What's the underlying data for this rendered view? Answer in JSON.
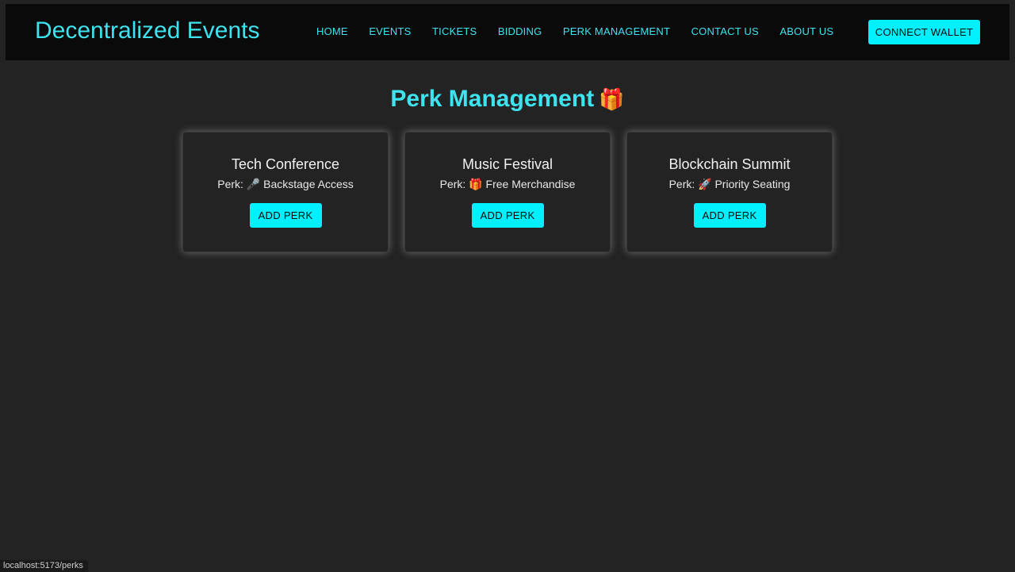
{
  "header": {
    "brand": "Decentralized Events",
    "nav": [
      {
        "label": "HOME"
      },
      {
        "label": "EVENTS"
      },
      {
        "label": "TICKETS"
      },
      {
        "label": "BIDDING"
      },
      {
        "label": "PERK MANAGEMENT"
      },
      {
        "label": "CONTACT US"
      },
      {
        "label": "ABOUT US"
      }
    ],
    "connect_label": "CONNECT WALLET"
  },
  "main": {
    "title": "Perk Management",
    "title_emoji": "🎁",
    "cards": [
      {
        "title": "Tech Conference",
        "perk": "Perk: 🎤 Backstage Access",
        "button": "ADD PERK"
      },
      {
        "title": "Music Festival",
        "perk": "Perk: 🎁 Free Merchandise",
        "button": "ADD PERK"
      },
      {
        "title": "Blockchain Summit",
        "perk": "Perk: 🚀 Priority Seating",
        "button": "ADD PERK"
      }
    ]
  },
  "status_bar": {
    "url": "localhost:5173/perks"
  },
  "colors": {
    "accent": "#00f0ff",
    "accent_text": "#3ee3f0",
    "background": "#232323",
    "navbar": "#0a0a0a"
  }
}
